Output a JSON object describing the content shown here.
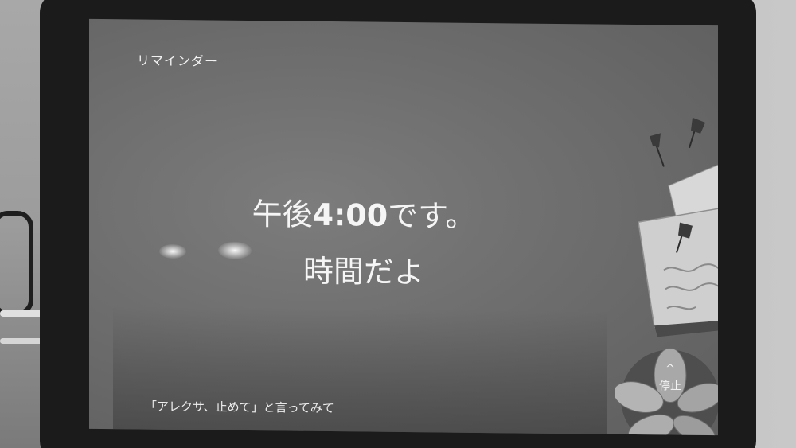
{
  "header": {
    "title": "リマインダー"
  },
  "message": {
    "prefix": "午後",
    "time": "4:00",
    "suffix": "です。",
    "line2": "時間だよ"
  },
  "hint": {
    "text": "「アレクサ、止めて」と言ってみて"
  },
  "stop_button": {
    "chevron": "^",
    "label": "停止"
  },
  "icons": {
    "memo": "pinned-memo-icon",
    "leaf": "leaf-plant-icon"
  }
}
